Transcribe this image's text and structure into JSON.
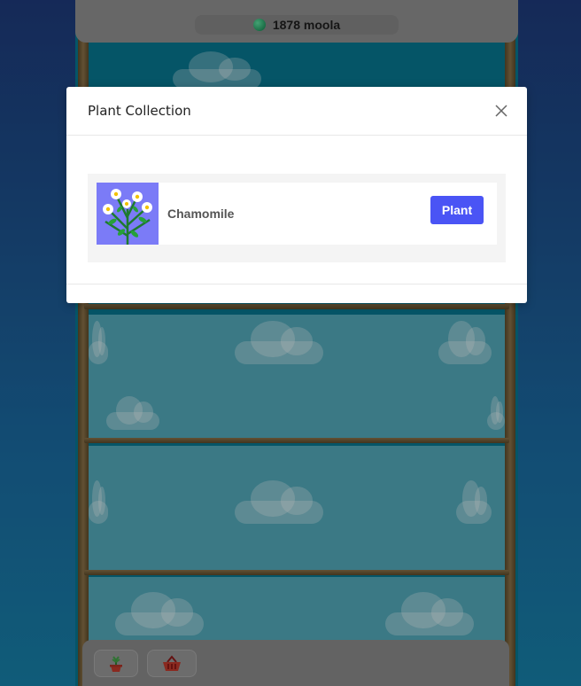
{
  "header": {
    "moola_amount": "1878",
    "moola_label": "moola",
    "moola_text": "1878 moola"
  },
  "modal": {
    "title": "Plant Collection",
    "close_label": "×",
    "plants": [
      {
        "name": "Chamomile",
        "action_label": "Plant",
        "thumbnail": "chamomile-flower-image"
      }
    ]
  },
  "toolbar": {
    "items": [
      {
        "icon": "potted-plant-icon"
      },
      {
        "icon": "basket-icon"
      }
    ]
  },
  "colors": {
    "accent": "#4a54f5",
    "thumbnail_bg": "#7b7bf7",
    "sky": "#52a8b9",
    "wood": "#6b5a36"
  }
}
